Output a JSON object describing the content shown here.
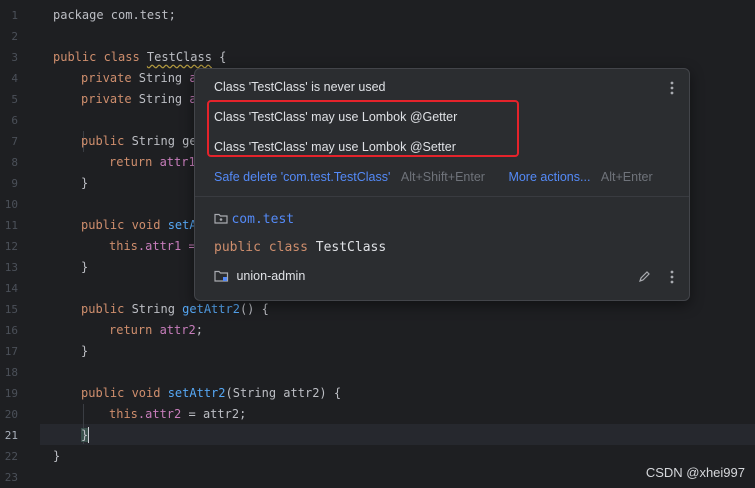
{
  "editor": {
    "line_numbers": [
      "1",
      "2",
      "3",
      "4",
      "5",
      "6",
      "7",
      "8",
      "9",
      "10",
      "11",
      "12",
      "13",
      "14",
      "15",
      "16",
      "17",
      "18",
      "19",
      "20",
      "21",
      "22",
      "23"
    ],
    "active_line": "21",
    "code": {
      "l1": "package com.test;",
      "l3_kw": "public class ",
      "l3_cls": "TestClass",
      "l3_end": " {",
      "l4_kw": "private ",
      "l4_type": "String ",
      "l4_tail": "a",
      "l5_kw": "private ",
      "l5_type": "String ",
      "l5_tail": "a",
      "l7_kw": "public ",
      "l7_tail": "String ge",
      "l8_kw": "return ",
      "l8_tail": "attr1",
      "l9": "}",
      "l11_kw": "public void ",
      "l11_tail": "setA",
      "l12_kw": "this",
      "l12_tail": ".attr1 =",
      "l13": "}",
      "l15_kw": "public ",
      "l15_type": "String ",
      "l15_fn": "getAttr2",
      "l15_end": "() {",
      "l16_kw": "return ",
      "l16_fld": "attr2",
      "l16_end": ";",
      "l17": "}",
      "l19_kw": "public void ",
      "l19_fn": "setAttr2",
      "l19_end": "(String attr2) {",
      "l20_kw": "this",
      "l20_fld": ".attr2",
      "l20_end": " = attr2;",
      "l21": "}",
      "l22": "}"
    }
  },
  "popup": {
    "warning": "Class 'TestClass' is never used",
    "menu_icon": "kebab-menu-icon",
    "actions": [
      "Class 'TestClass' may use Lombok @Getter",
      "Class 'TestClass' may use Lombok @Setter"
    ],
    "safe_delete_label": "Safe delete 'com.test.TestClass'",
    "safe_delete_shortcut": "Alt+Shift+Enter",
    "more_actions_label": "More actions...",
    "more_actions_shortcut": "Alt+Enter",
    "package_name": "com.test",
    "declaration_kw": "public class ",
    "declaration_name": "TestClass",
    "module_name": "union-admin",
    "edit_icon": "pencil-icon"
  },
  "colors": {
    "background": "#1e1f22",
    "keyword": "#cf8e6d",
    "field": "#c77dbb",
    "method": "#56a8f5",
    "link": "#548af7",
    "highlight_border": "#e5232b"
  },
  "watermark": "CSDN @xhei997"
}
